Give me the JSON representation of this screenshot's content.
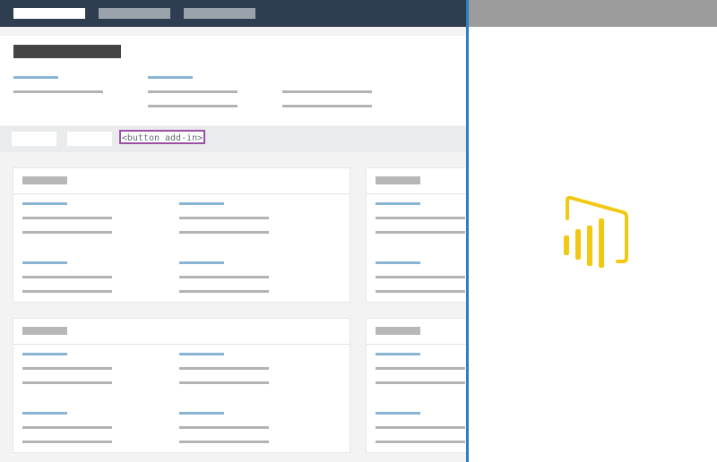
{
  "toolbar": {
    "addin_button_label": "<button add-in>"
  },
  "header_card": {
    "columns": 3
  },
  "cards": [
    {
      "title": "",
      "fields": 4
    },
    {
      "title": "",
      "fields": 4
    },
    {
      "title": "",
      "fields": 4
    },
    {
      "title": "",
      "fields": 4
    }
  ],
  "taskpane": {
    "title": "",
    "logo": "power-bi-logo-icon"
  },
  "colors": {
    "topbar": "#2e3d50",
    "accent_blue": "#2f7fc1",
    "placeholder_blue": "#89b4d4",
    "placeholder_gray": "#b3b3b3",
    "addin_border": "#9b4fa6",
    "logo_yellow": "#f2c811"
  }
}
